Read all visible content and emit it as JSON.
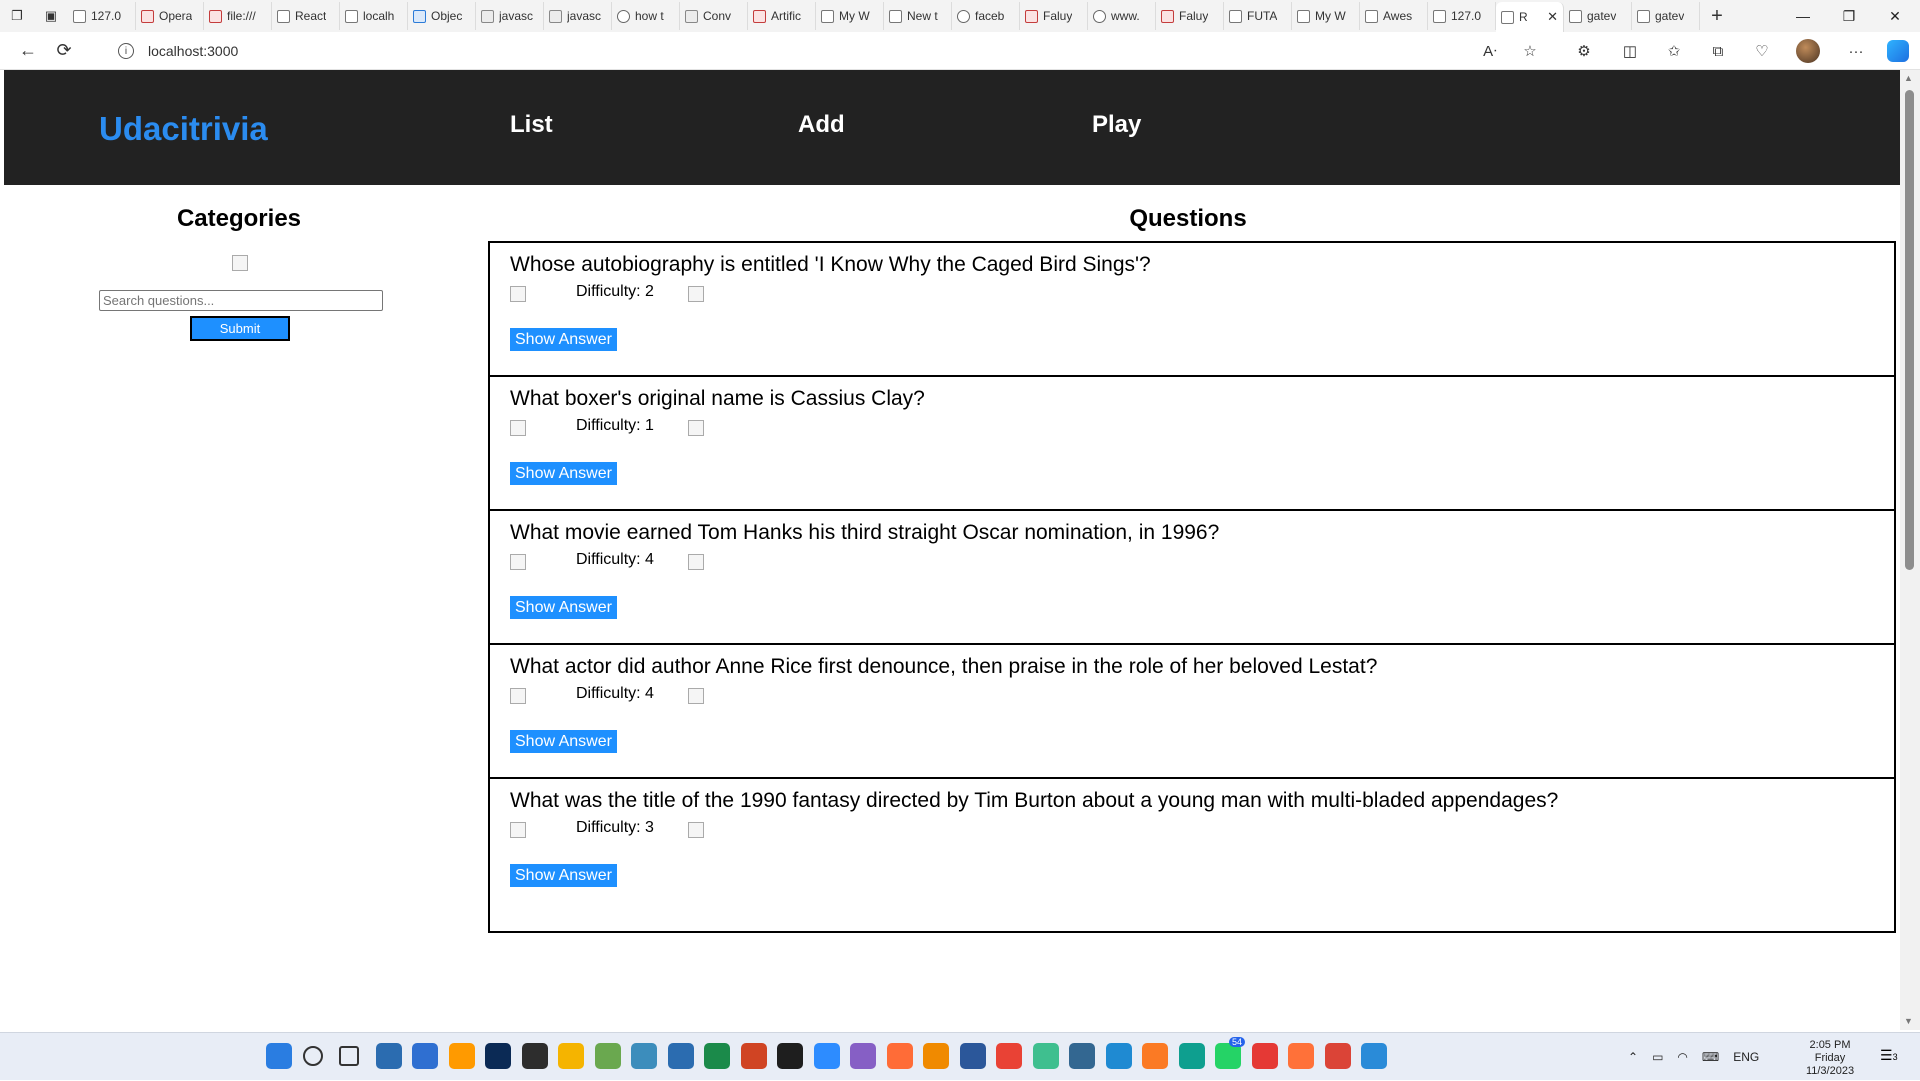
{
  "browser": {
    "tabs": [
      {
        "label": "127.0",
        "icon": "page-icon",
        "kind": "page"
      },
      {
        "label": "Opera",
        "icon": "pdf-icon",
        "kind": "pdf"
      },
      {
        "label": "file:///",
        "icon": "pdf-icon",
        "kind": "pdf"
      },
      {
        "label": "React",
        "icon": "page-icon",
        "kind": "page"
      },
      {
        "label": "localh",
        "icon": "window-icon",
        "kind": "page"
      },
      {
        "label": "Objec",
        "icon": "bing-icon",
        "kind": "bing"
      },
      {
        "label": "javasc",
        "icon": "chat-icon",
        "kind": "gpt"
      },
      {
        "label": "javasc",
        "icon": "chat-icon",
        "kind": "gpt"
      },
      {
        "label": "how t",
        "icon": "search-icon",
        "kind": "search"
      },
      {
        "label": "Conv",
        "icon": "chat-icon",
        "kind": "gpt"
      },
      {
        "label": "Artific",
        "icon": "pdf-icon",
        "kind": "pdf"
      },
      {
        "label": "My W",
        "icon": "page-icon",
        "kind": "page"
      },
      {
        "label": "New t",
        "icon": "newtab-icon",
        "kind": "page"
      },
      {
        "label": "faceb",
        "icon": "search-icon",
        "kind": "search"
      },
      {
        "label": "Faluy",
        "icon": "pdf-icon",
        "kind": "pdf"
      },
      {
        "label": "www.",
        "icon": "search-icon",
        "kind": "search"
      },
      {
        "label": "Faluy",
        "icon": "pdf-icon",
        "kind": "pdf"
      },
      {
        "label": "FUTA",
        "icon": "page-icon",
        "kind": "page"
      },
      {
        "label": "My W",
        "icon": "page-icon",
        "kind": "page"
      },
      {
        "label": "Awes",
        "icon": "page-icon",
        "kind": "page"
      },
      {
        "label": "127.0",
        "icon": "page-icon",
        "kind": "page"
      },
      {
        "label": "R",
        "icon": "page-icon",
        "kind": "page",
        "active": true
      },
      {
        "label": "gatev",
        "icon": "page-icon",
        "kind": "page"
      },
      {
        "label": "gatev",
        "icon": "page-icon",
        "kind": "page"
      }
    ],
    "url": "localhost:3000"
  },
  "app": {
    "brand": "Udacitrivia",
    "nav": {
      "list": "List",
      "add": "Add",
      "play": "Play"
    },
    "sidebar": {
      "title": "Categories",
      "search_placeholder": "Search questions...",
      "submit_label": "Submit"
    },
    "questions": {
      "title": "Questions",
      "show_answer_label": "Show Answer",
      "items": [
        {
          "question": "Whose autobiography is entitled 'I Know Why the Caged Bird Sings'?",
          "difficulty": "Difficulty: 2"
        },
        {
          "question": "What boxer's original name is Cassius Clay?",
          "difficulty": "Difficulty: 1"
        },
        {
          "question": "What movie earned Tom Hanks his third straight Oscar nomination, in 1996?",
          "difficulty": "Difficulty: 4"
        },
        {
          "question": "What actor did author Anne Rice first denounce, then praise in the role of her beloved Lestat?",
          "difficulty": "Difficulty: 4"
        },
        {
          "question": "What was the title of the 1990 fantasy directed by Tim Burton about a young man with multi-bladed appendages?",
          "difficulty": "Difficulty: 3"
        }
      ]
    }
  },
  "taskbar": {
    "badge_count": "54",
    "language": "ENG",
    "time": "2:05 PM",
    "day": "Friday",
    "date": "11/3/2023",
    "notification_count": "3"
  },
  "colors": {
    "nav_background": "#222222",
    "brand": "#2b8cf0",
    "button_blue": "#1e90ff"
  }
}
